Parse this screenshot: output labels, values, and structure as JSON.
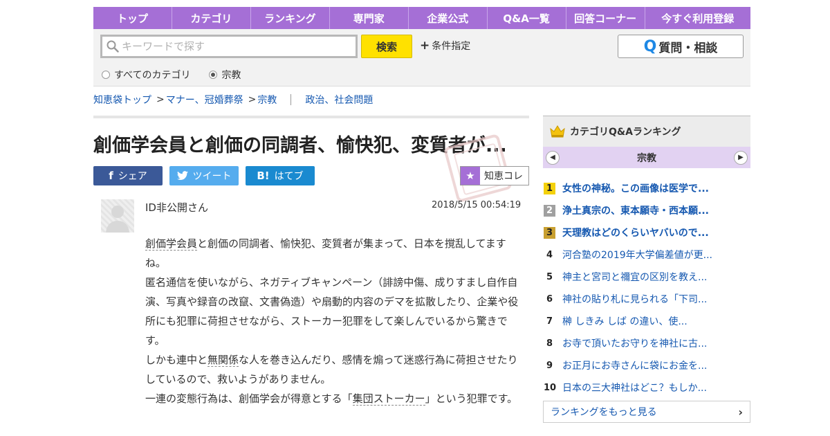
{
  "nav": {
    "items": [
      "トップ",
      "カテゴリ",
      "ランキング",
      "専門家",
      "企業公式",
      "Q&A一覧",
      "回答コーナー",
      "今すぐ利用登録"
    ]
  },
  "search": {
    "placeholder": "キーワードで探す",
    "button": "検索",
    "condition": "条件指定",
    "ask_q": "Q",
    "ask_label": "質問・相談",
    "radio_all": "すべてのカテゴリ",
    "radio_cat": "宗教",
    "radio_selected": "宗教"
  },
  "breadcrumb": {
    "items": [
      "知恵袋トップ",
      "マナー、冠婚葬祭",
      "宗教"
    ],
    "separator": ">",
    "related": "政治、社会問題"
  },
  "question": {
    "title": "創価学会員と創価の同調者、愉快犯、変質者が...",
    "share_fb": "シェア",
    "share_tw": "ツイート",
    "share_hb": "はてブ",
    "chiecole": "知恵コレ",
    "user": "ID非公開さん",
    "date": "2018/5/15 00:54:19",
    "body": {
      "kw1": "創価学会員",
      "p1_rest": "と創価の同調者、愉快犯、変質者が集まって、日本を撹乱してますね。",
      "p2": "匿名通信を使いながら、ネガティブキャンペーン（誹謗中傷、成りすまし自作自演、写真や録音の改竄、文書偽造）や扇動的内容のデマを拡散したり、企業や役所にも犯罪に荷担させながら、ストーカー犯罪をして楽しんでいるから驚きです。",
      "p3_a": "しかも連中と",
      "kw2": "無関係",
      "p3_b": "な人を巻き込んだり、感情を煽って迷惑行為に荷担させたりしているので、救いようがありません。",
      "p4_a": "一連の変態行為は、創価学会が得意とする「",
      "kw3": "集団ストーカー",
      "p4_b": "」という犯罪です。"
    }
  },
  "ranking": {
    "title": "カテゴリQ&Aランキング",
    "category": "宗教",
    "items": [
      {
        "rank": "1",
        "text": "女性の神秘。この画像は医学で..."
      },
      {
        "rank": "2",
        "text": "浄土真宗の、東本願寺・西本願..."
      },
      {
        "rank": "3",
        "text": "天理教はどのくらいヤバいので..."
      },
      {
        "rank": "4",
        "text": "河合塾の2019年大学偏差値が更..."
      },
      {
        "rank": "5",
        "text": "神主と宮司と禰宜の区別を教え..."
      },
      {
        "rank": "6",
        "text": "神社の貼り札に見られる「下司..."
      },
      {
        "rank": "7",
        "text": "榊 しきみ しば の違い、使..."
      },
      {
        "rank": "8",
        "text": "お寺で頂いたお守りを神社に古..."
      },
      {
        "rank": "9",
        "text": "お正月にお寺さんに袋にお金を..."
      },
      {
        "rank": "10",
        "text": "日本の三大神社はどこ？もしか..."
      }
    ],
    "more": "ランキングをもっと見る"
  },
  "colors": {
    "nav_purple": "#a56fd6",
    "search_yellow": "#ffe100",
    "link_blue": "#1558b0",
    "facebook": "#3b5998",
    "twitter": "#55acee",
    "hatena": "#1a8ad0"
  },
  "icons": {
    "search": "search-icon",
    "crown": "crown-icon",
    "star": "star-icon",
    "chevron_left": "chevron-left-icon",
    "chevron_right": "chevron-right-icon"
  }
}
